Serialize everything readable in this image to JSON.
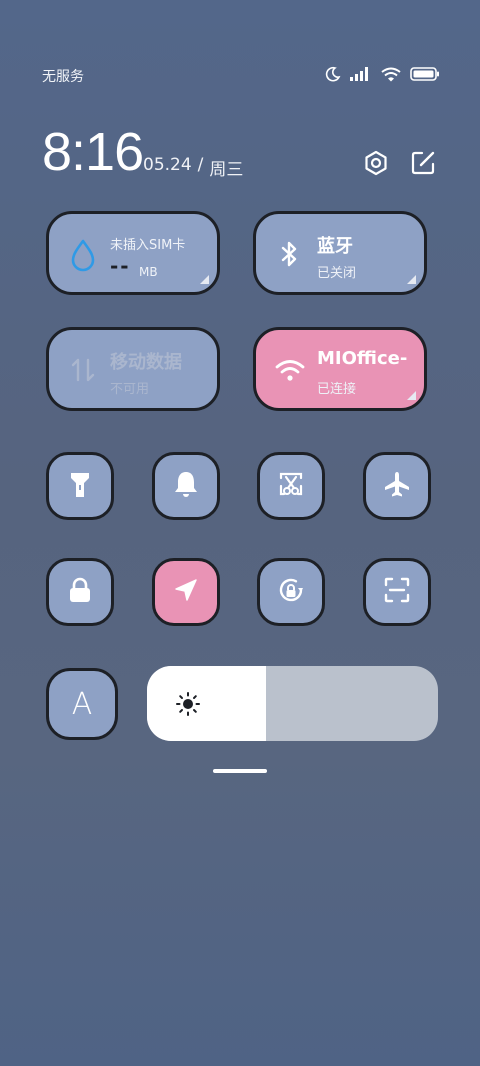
{
  "status_bar": {
    "carrier": "无服务",
    "icons": [
      "moon-icon",
      "signal-icon",
      "wifi-icon",
      "battery-icon"
    ]
  },
  "header": {
    "time": "8:16",
    "date": "05.24",
    "separator": "/",
    "weekday": "周三",
    "icons": [
      "settings-icon",
      "edit-icon"
    ]
  },
  "tiles": {
    "data_usage": {
      "title": "未插入SIM卡",
      "value": "--",
      "unit": "MB",
      "icon": "water-drop-icon"
    },
    "bluetooth": {
      "title": "蓝牙",
      "status": "已关闭",
      "icon": "bluetooth-icon"
    },
    "mobile_data": {
      "title": "移动数据",
      "status": "不可用",
      "icon": "mobile-data-icon"
    },
    "wifi": {
      "title": "MIOffice-",
      "status": "已连接",
      "icon": "wifi-icon"
    }
  },
  "toggles": [
    {
      "name": "flashlight",
      "icon": "flashlight-icon",
      "active": false
    },
    {
      "name": "ringer",
      "icon": "bell-icon",
      "active": false
    },
    {
      "name": "screenshot",
      "icon": "scissors-icon",
      "active": false
    },
    {
      "name": "airplane",
      "icon": "airplane-icon",
      "active": false
    },
    {
      "name": "lock",
      "icon": "lock-icon",
      "active": false
    },
    {
      "name": "location",
      "icon": "location-arrow-icon",
      "active": true
    },
    {
      "name": "rotation-lock",
      "icon": "rotation-lock-icon",
      "active": false
    },
    {
      "name": "scanner",
      "icon": "scan-icon",
      "active": false
    }
  ],
  "auto_brightness": {
    "label": "A"
  },
  "brightness": {
    "level": 0.41,
    "icon": "sun-icon"
  },
  "colors": {
    "tile": "#8ea1c5",
    "active": "#e993b5",
    "border": "#1d2026",
    "accent": "#2f9ae6"
  }
}
